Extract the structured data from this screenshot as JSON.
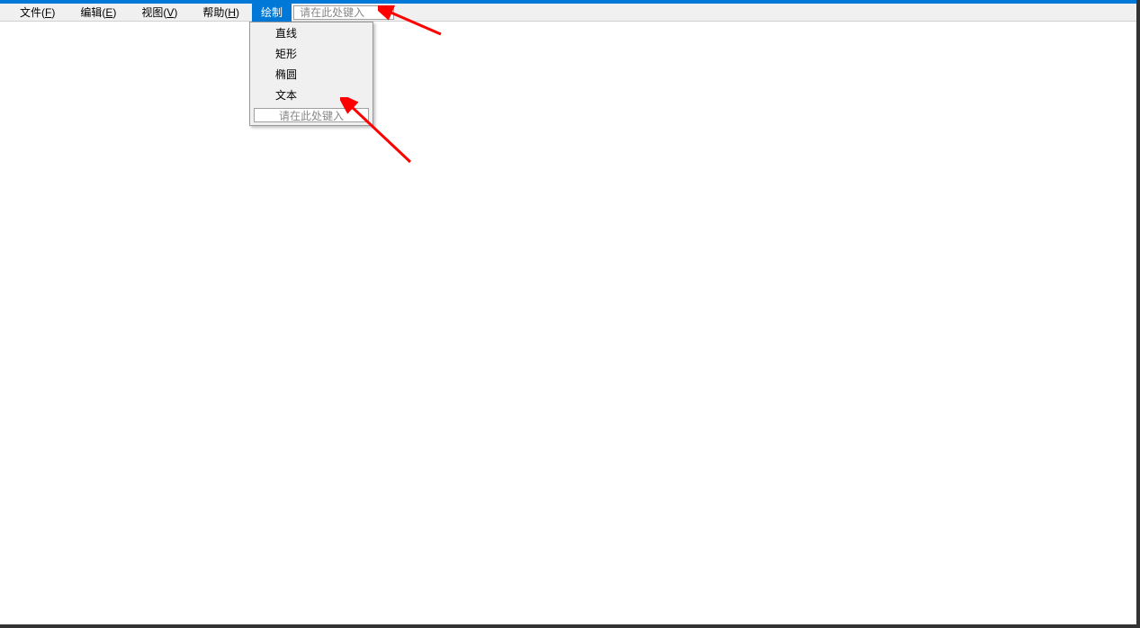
{
  "menubar": {
    "items": [
      {
        "label_prefix": "文件(",
        "accel": "F",
        "label_suffix": ")"
      },
      {
        "label_prefix": "编辑(",
        "accel": "E",
        "label_suffix": ")"
      },
      {
        "label_prefix": "视图(",
        "accel": "V",
        "label_suffix": ")"
      },
      {
        "label_prefix": "帮助(",
        "accel": "H",
        "label_suffix": ")"
      }
    ],
    "selected_label": "绘制",
    "input_placeholder": "请在此处键入"
  },
  "dropdown": {
    "items": [
      {
        "label": "直线"
      },
      {
        "label": "矩形"
      },
      {
        "label": "椭圆"
      },
      {
        "label": "文本"
      }
    ],
    "input_placeholder": "请在此处键入"
  },
  "colors": {
    "accent": "#0078d7",
    "menu_bg": "#f0f0f0",
    "arrow": "#ff0000"
  }
}
